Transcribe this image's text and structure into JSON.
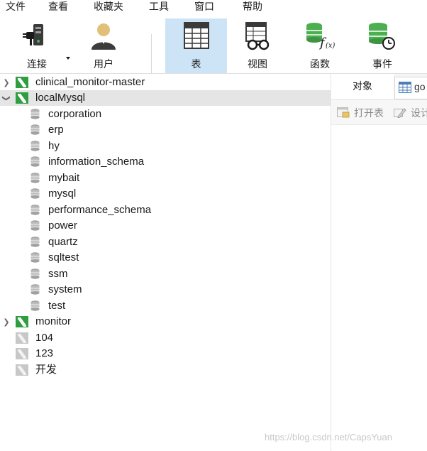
{
  "menu": {
    "items": [
      {
        "label": "文件"
      },
      {
        "label": "查看"
      },
      {
        "label": "收藏夹"
      },
      {
        "label": "工具"
      },
      {
        "label": "窗口"
      },
      {
        "label": "帮助"
      }
    ]
  },
  "toolbar": {
    "connect_label": "连接",
    "user_label": "用户",
    "table_label": "表",
    "view_label": "视图",
    "function_label": "函数",
    "event_label": "事件",
    "active": "表",
    "accent_color": "#cde4f7"
  },
  "tree": {
    "connections": [
      {
        "name": "clinical_monitor-master",
        "expanded": false,
        "icon": "mysql-connection-icon"
      },
      {
        "name": "localMysql",
        "expanded": true,
        "selected": true,
        "icon": "mysql-connection-icon"
      }
    ],
    "databases": [
      "corporation",
      "erp",
      "hy",
      "information_schema",
      "mybait",
      "mysql",
      "performance_schema",
      "power",
      "quartz",
      "sqltest",
      "ssm",
      "system",
      "test"
    ],
    "more_connections": [
      {
        "name": "monitor",
        "expanded": false,
        "icon": "mysql-connection-icon"
      },
      {
        "name": "104",
        "icon": "disconnected-connection-icon"
      },
      {
        "name": "123",
        "icon": "disconnected-connection-icon"
      },
      {
        "name": "开发",
        "icon": "disconnected-connection-icon"
      }
    ],
    "selected_color": "#e5e5e5"
  },
  "right_pane": {
    "tab_objects": "对象",
    "tab_table_label": "go",
    "open_table_label": "打开表",
    "design_label": "设计"
  },
  "watermark": "https://blog.csdn.net/CapsYuan"
}
